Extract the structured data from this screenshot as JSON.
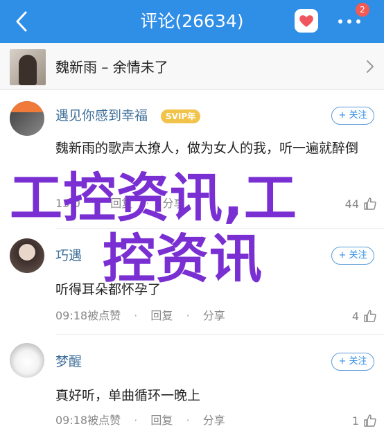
{
  "header": {
    "title": "评论(26634)",
    "badge_count": "2",
    "accent": "#2f8ee6"
  },
  "song": {
    "label": "魏新雨 – 余情未了",
    "cover_label": "icon:album-cover"
  },
  "comments": [
    {
      "user": "遇见你感到幸福",
      "vip": "SVIP年",
      "follow": "+ 关注",
      "text": "魏新雨的歌声太撩人，做为女人的我，听一遍就醉倒",
      "time": "13:0",
      "reply": "回复",
      "share": "分享",
      "likes": "44"
    },
    {
      "user": "巧遇",
      "follow": "+ 关注",
      "text": "听得耳朵都怀孕了",
      "time": "09:18被点赞",
      "reply": "回复",
      "share": "分享",
      "likes": "4"
    },
    {
      "user": "梦醒",
      "follow": "+ 关注",
      "text": "真好听，单曲循环一晚上",
      "time": "09:18被点赞",
      "reply": "回复",
      "share": "分享",
      "likes": "1"
    }
  ],
  "separator": "·",
  "watermark": {
    "line1": "工控资讯,工",
    "line2": "控资讯",
    "color": "#7a2fd2"
  }
}
